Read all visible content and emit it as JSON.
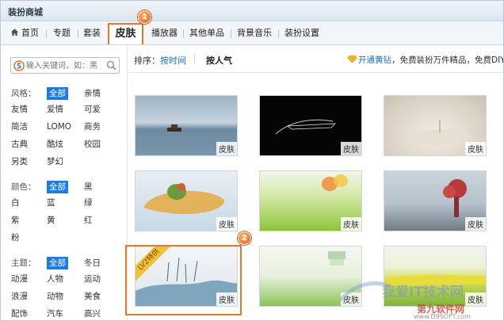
{
  "window": {
    "title": "装扮商城"
  },
  "nav": {
    "home": "首页",
    "items": [
      "专题",
      "套装",
      "皮肤",
      "播放器",
      "其他单品",
      "背景音乐",
      "装扮设置"
    ]
  },
  "badges": {
    "one": "1",
    "two": "2"
  },
  "search": {
    "placeholder": "输入关键词，如：黑"
  },
  "filters": {
    "style": {
      "label": "风格：",
      "options": [
        "全部",
        "亲情",
        "友情",
        "爱情",
        "可爱",
        "简洁",
        "LOMO",
        "商务",
        "古典",
        "酷炫",
        "校园",
        "另类",
        "梦幻"
      ]
    },
    "color": {
      "label": "颜色：",
      "options": [
        "全部",
        "黑",
        "白",
        "蓝",
        "绿",
        "紫",
        "黄",
        "红",
        "粉"
      ]
    },
    "theme": {
      "label": "主题：",
      "options": [
        "全部",
        "冬日",
        "动漫",
        "人物",
        "运动",
        "浪漫",
        "动物",
        "美食",
        "配饰",
        "汽车",
        "高兴"
      ]
    }
  },
  "sort": {
    "label": "排序：",
    "by_time": "按时间",
    "by_popularity": "按人气"
  },
  "promo": {
    "link": "开通黄钻",
    "text": "，免费装扮万件精品，免费DIY"
  },
  "skins": [
    {
      "caption": "皮肤"
    },
    {
      "caption": "皮肤"
    },
    {
      "caption": "皮肤"
    },
    {
      "caption": "皮肤"
    },
    {
      "caption": "皮肤"
    },
    {
      "caption": "皮肤"
    },
    {
      "caption": "皮肤",
      "ribbon": "LV2特供"
    },
    {
      "caption": "皮肤"
    },
    {
      "caption": "皮肤"
    }
  ],
  "watermark": {
    "title": "我爱IT技术网",
    "sub": "第九软件网",
    "url": "www.D9SOFT.com"
  },
  "colors": {
    "accent": "#e8782a",
    "link": "#1c6fc7",
    "selected": "#1c7be6"
  }
}
